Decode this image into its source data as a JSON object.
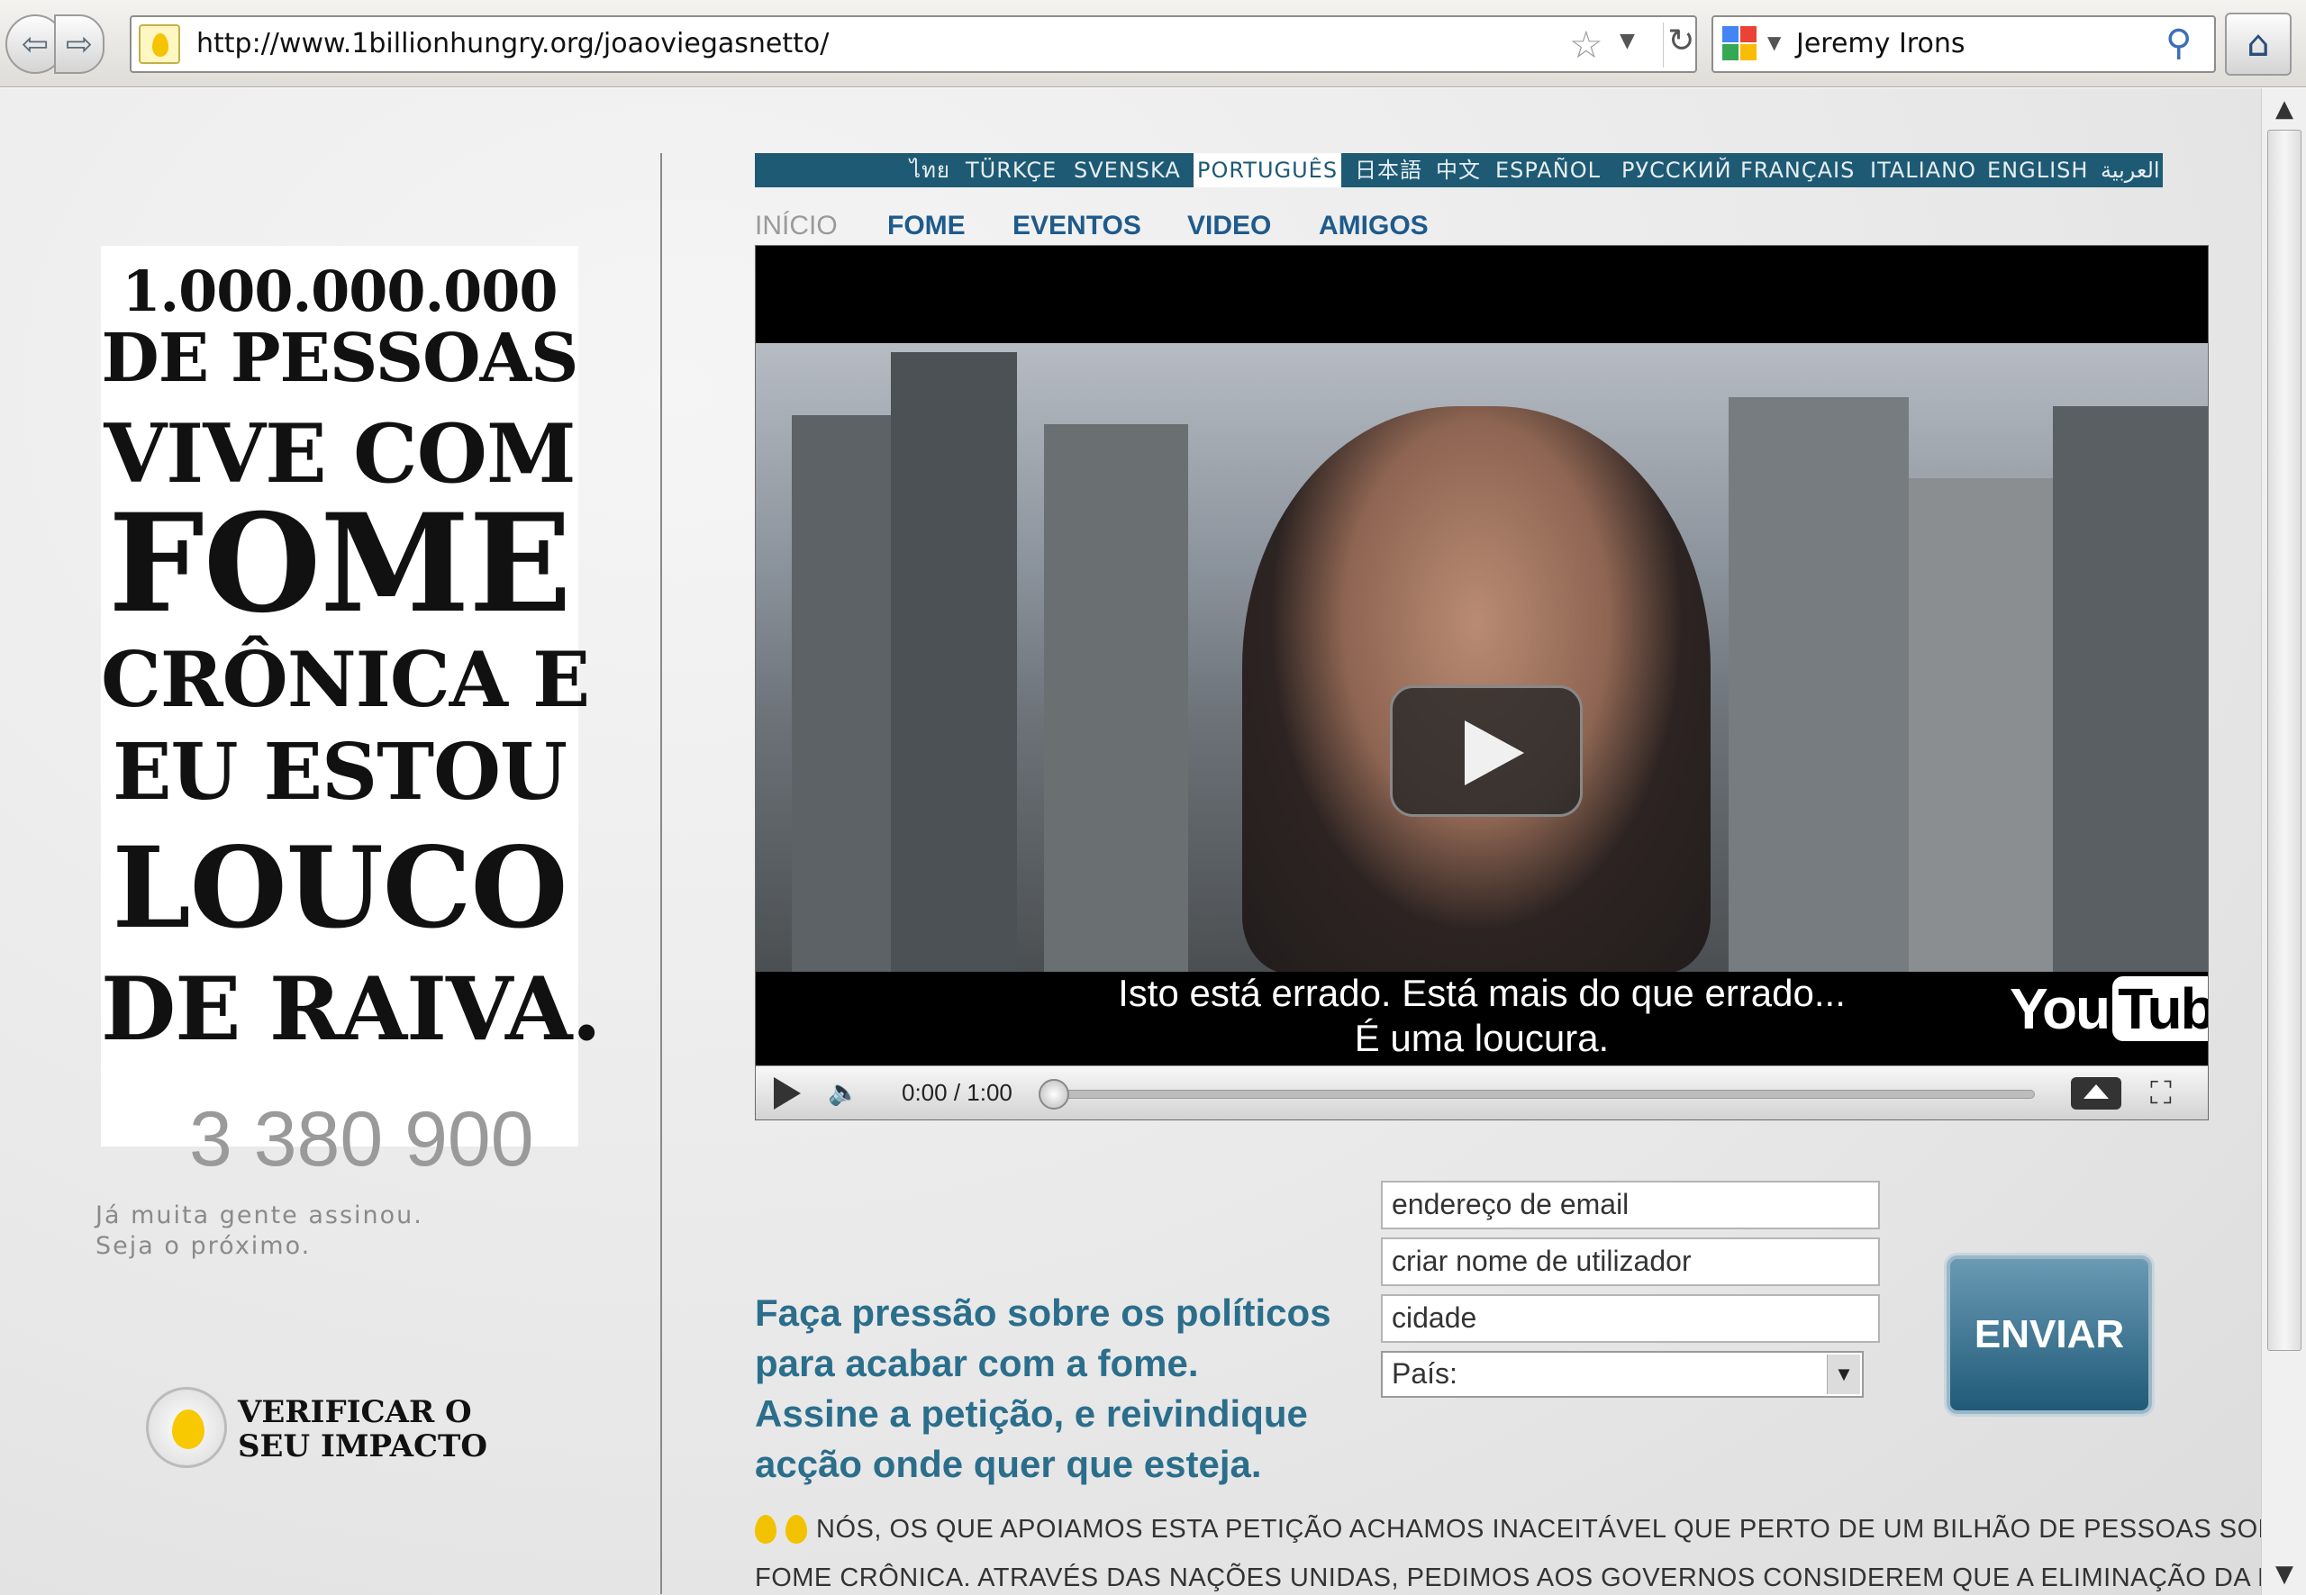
{
  "browser": {
    "url": "http://www.1billionhungry.org/joaoviegasnetto/",
    "search_query": "Jeremy Irons",
    "icons": {
      "back": "back-arrow-icon",
      "forward": "forward-arrow-icon",
      "bookmark": "star-icon",
      "reload": "reload-icon",
      "search": "magnifier-icon",
      "home": "home-icon"
    }
  },
  "poster": {
    "lines": [
      "1.000.000.000",
      "DE PESSOAS",
      "VIVE COM",
      "FOME",
      "CRÔNICA E",
      "EU ESTOU",
      "LOUCO",
      "DE RAIVA."
    ]
  },
  "counter": {
    "value": "3 380 900",
    "line1": "Já muita gente assinou.",
    "line2": "Seja o próximo."
  },
  "impact": {
    "line1": "VERIFICAR O",
    "line2": "SEU IMPACTO"
  },
  "languages": [
    "ไทย",
    "TÜRKÇE",
    "SVENSKA",
    "PORTUGUÊS",
    "日本語",
    "中文",
    "ESPAÑOL",
    "РУССКИЙ",
    "FRANÇAIS",
    "ITALIANO",
    "ENGLISH",
    "العربية"
  ],
  "active_language": "PORTUGUÊS",
  "nav": {
    "inicio": "INÍCIO",
    "fome": "FOME",
    "eventos": "EVENTOS",
    "video": "VIDEO",
    "amigos": "AMIGOS"
  },
  "video": {
    "subtitle_line1": "Isto está errado. Está mais do que errado...",
    "subtitle_line2": "É uma loucura.",
    "logo_you": "You",
    "logo_tube": "Tube",
    "time": "0:00 / 1:00",
    "progress": 0
  },
  "petition": {
    "text": "Faça pressão sobre os políticos para acabar com a fome. Assine a petição, e reivindique acção onde quer que esteja.",
    "email_placeholder": "endereço de email",
    "username_placeholder": "criar nome de utilizador",
    "city_placeholder": "cidade",
    "country_label": "País:",
    "submit": "ENVIAR"
  },
  "statement": {
    "line1": "NÓS, OS QUE APOIAMOS ESTA PETIÇÃO ACHAMOS INACEITÁVEL QUE PERTO DE UM BILHÃO DE PESSOAS SOFRA DE",
    "line2": "FOME CRÔNICA. ATRAVÉS DAS NAÇÕES UNIDAS, PEDIMOS AOS GOVERNOS CONSIDEREM QUE A ELIMINAÇÃO DA FOME"
  },
  "colors": {
    "accent": "#1e5a74",
    "link": "#1e5a8c",
    "petition_text": "#2b6e8c",
    "brand_yellow": "#f2c200"
  }
}
